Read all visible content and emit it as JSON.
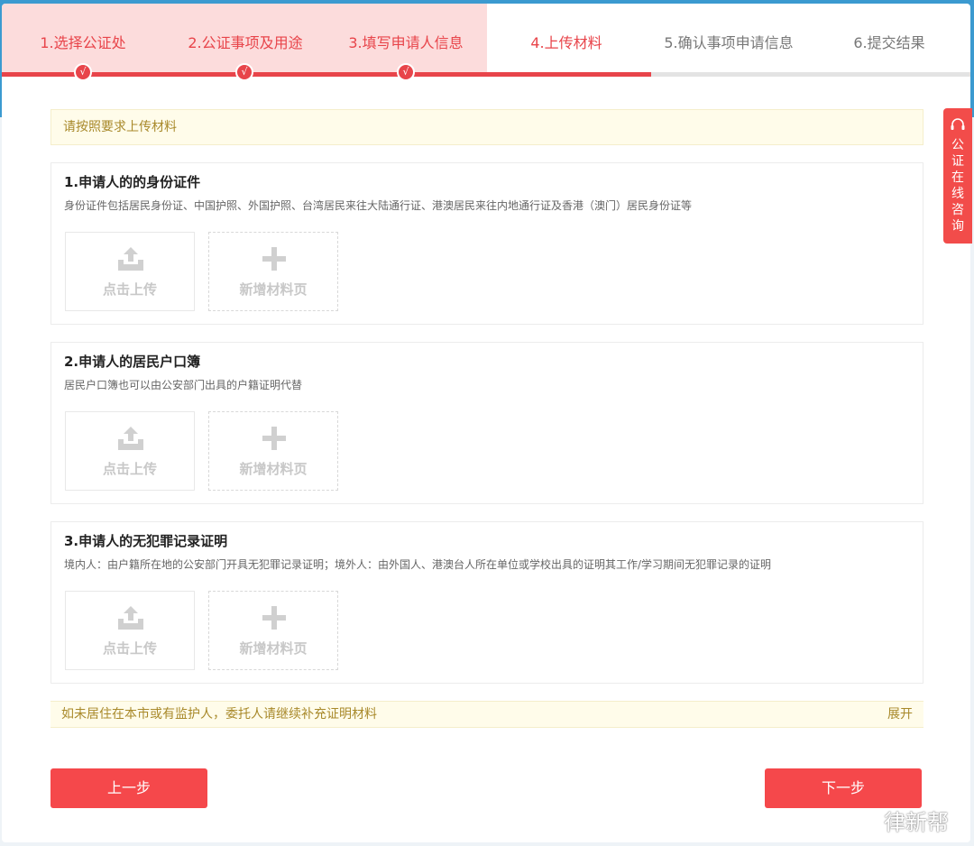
{
  "steps": [
    {
      "label": "1.选择公证处",
      "state": "done"
    },
    {
      "label": "2.公证事项及用途",
      "state": "done"
    },
    {
      "label": "3.填写申请人信息",
      "state": "done"
    },
    {
      "label": "4.上传材料",
      "state": "active"
    },
    {
      "label": "5.确认事项申请信息",
      "state": "todo"
    },
    {
      "label": "6.提交结果",
      "state": "todo"
    }
  ],
  "check_mark": "√",
  "notice": "请按照要求上传材料",
  "sections": [
    {
      "title": "1.申请人的的身份证件",
      "desc": "身份证件包括居民身份证、中国护照、外国护照、台湾居民来往大陆通行证、港澳居民来往内地通行证及香港（澳门）居民身份证等"
    },
    {
      "title": "2.申请人的居民户口簿",
      "desc": "居民户口簿也可以由公安部门出具的户籍证明代替"
    },
    {
      "title": "3.申请人的无犯罪记录证明",
      "desc": "境内人：由户籍所在地的公安部门开具无犯罪记录证明；境外人：由外国人、港澳台人所在单位或学校出具的证明其工作/学习期间无犯罪记录的证明"
    }
  ],
  "upload_label": "点击上传",
  "add_page_label": "新增材料页",
  "extra_notice": "如未居住在本市或有监护人，委托人请继续补充证明材料",
  "expand_label": "展开",
  "prev_label": "上一步",
  "next_label": "下一步",
  "side_consult": "公证在线咨询",
  "watermark": "律新帮",
  "colors": {
    "accent": "#e8444a",
    "button": "#f5484b",
    "notice_bg": "#fffcea",
    "notice_text": "#a8892a"
  }
}
